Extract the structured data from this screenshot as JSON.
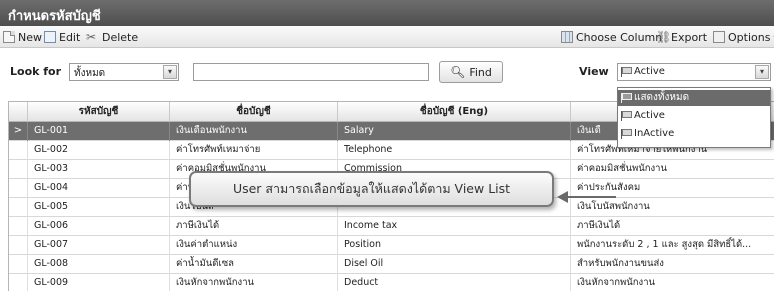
{
  "window": {
    "title": "กำหนดรหัสบัญชี"
  },
  "toolbar": {
    "new_label": "New",
    "edit_label": "Edit",
    "delete_label": "Delete",
    "choose_column_label": "Choose Column",
    "export_label": "Export",
    "options_label": "Options"
  },
  "filter": {
    "look_for_label": "Look for",
    "look_for_value": "ทั้งหมด",
    "search_value": "",
    "find_label": "Find",
    "view_label": "View",
    "view_value": "Active"
  },
  "view_dropdown": {
    "options": [
      "แสดงทั้งหมด",
      "Active",
      "InActive"
    ]
  },
  "grid": {
    "columns": [
      "รหัสบัญชี",
      "ชื่อบัญชี",
      "ชื่อบัญชี (Eng)",
      ""
    ],
    "rows": [
      {
        "marker": ">",
        "code": "GL-001",
        "name": "เงินเดือนพนักงาน",
        "name_en": "Salary",
        "desc": "เงินเดื"
      },
      {
        "marker": "",
        "code": "GL-002",
        "name": "ค่าโทรศัพท์เหมาจ่าย",
        "name_en": "Telephone",
        "desc": "ค่าโทรศัพท์เหมาจ่ายให้พนักงาน"
      },
      {
        "marker": "",
        "code": "GL-003",
        "name": "ค่าคอมมิสชั่นพนักงาน",
        "name_en": "Commission",
        "desc": "ค่าคอมมิสชั่นพนักงาน"
      },
      {
        "marker": "",
        "code": "GL-004",
        "name": "ค่าประกัน",
        "name_en": "",
        "desc": "ค่าประกันสังคม"
      },
      {
        "marker": "",
        "code": "GL-005",
        "name": "เงินโบนัส",
        "name_en": "",
        "desc": "เงินโบนัสพนักงาน"
      },
      {
        "marker": "",
        "code": "GL-006",
        "name": "ภาษีเงินได้",
        "name_en": "Income tax",
        "desc": "ภาษีเงินได้"
      },
      {
        "marker": "",
        "code": "GL-007",
        "name": "เงินค่าตำแหน่ง",
        "name_en": "Position",
        "desc": "พนักงานระดับ 2 , 1 และ สูงสุด มีสิทธิ์ได้..."
      },
      {
        "marker": "",
        "code": "GL-008",
        "name": "ค่าน้ำมันดีเซล",
        "name_en": "Disel Oil",
        "desc": "สำหรับพนักงานขนส่ง"
      },
      {
        "marker": "",
        "code": "GL-009",
        "name": "เงินหักจากพนักงาน",
        "name_en": "Deduct",
        "desc": "เงินหักจากพนักงาน"
      }
    ]
  },
  "annotation": {
    "text": "User สามารถเลือกข้อมูลให้แสดงได้ตาม View List"
  }
}
